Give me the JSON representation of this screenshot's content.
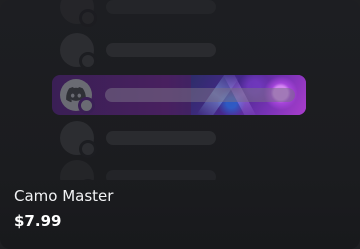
{
  "item": {
    "name": "Camo Master",
    "price": "$7.99"
  },
  "preview": {
    "icons": {
      "highlight_avatar": "discord-logo-icon"
    },
    "colors": {
      "background": "#1e1f22",
      "highlight": "#48205f",
      "accent": "#b040d0"
    }
  }
}
